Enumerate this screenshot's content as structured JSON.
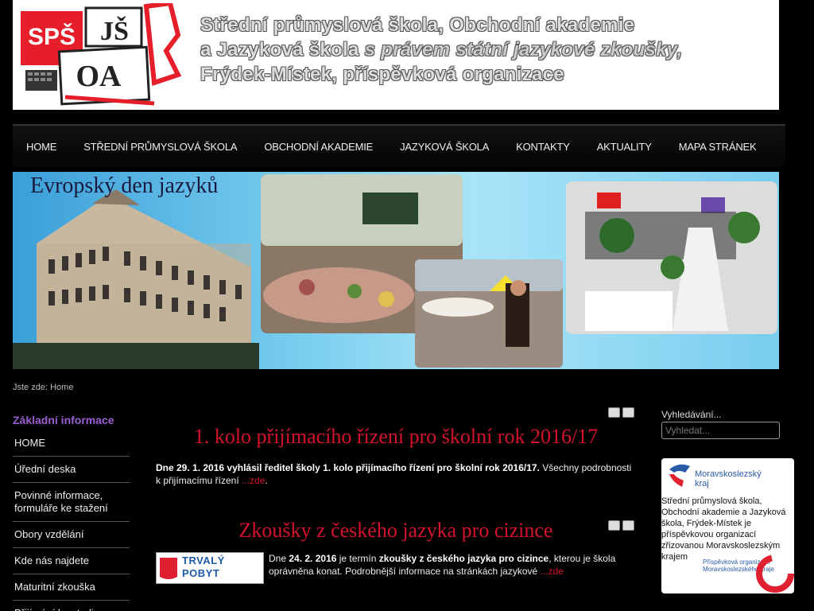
{
  "header": {
    "logo": {
      "line1_left": "SPŠ",
      "line1_right": "JŠ",
      "line2": "OA"
    },
    "line1": "Střední průmyslová škola, Obchodní akademie",
    "line2_prefix": "a Jazyková škola",
    "line2_italic": "s právem státní jazykové zkoušky,",
    "line3": "Frýdek-Místek, příspěvková organizace"
  },
  "nav": {
    "items": [
      "HOME",
      "STŘEDNÍ PRŮMYSLOVÁ ŠKOLA",
      "OBCHODNÍ AKADEMIE",
      "JAZYKOVÁ ŠKOLA",
      "KONTAKTY",
      "AKTUALITY",
      "MAPA STRÁNEK"
    ]
  },
  "hero": {
    "title": "Evropský den jazyků"
  },
  "breadcrumb": {
    "prefix": "Jste zde:",
    "current": "Home"
  },
  "left": {
    "title": "Základní informace",
    "items": [
      "HOME",
      "Úřední deska",
      "Povinné informace, formuláře ke stažení",
      "Obory vzdělání",
      "Kde nás najdete",
      "Maturitní zkouška",
      "Přijímání ke studiu"
    ]
  },
  "articles": [
    {
      "title": "1. kolo přijímacího řízení pro školní rok 2016/17",
      "text_bold": "Dne 29. 1. 2016 vyhlásil ředitel školy 1. kolo přijímacího řízení pro školní rok 2016/17.",
      "text_rest": "  Všechny podrobnosti k přijímacímu řízení",
      "link": "...zde",
      "end": "."
    },
    {
      "title": "Zkoušky z českého jazyka pro cizince",
      "badge": "TRVALÝ POBYT",
      "text_a": "Dne ",
      "text_b": "24. 2. 2016",
      "text_c": " je termín ",
      "text_d": "zkoušky z českého jazyka pro cizince",
      "text_e": ", kterou je škola oprávněna konat. Podrobnější informace na stránkách jazykové ",
      "link": "...zde"
    }
  ],
  "right": {
    "search_label": "Vyhledávání...",
    "search_placeholder": "Vyhledat...",
    "msk_logo_line1": "Moravskoslezský",
    "msk_logo_line2": "kraj",
    "msk_text": "Střední průmyslová škola, Obchodní akademie a Jazyková škola, Frýdek-Místek je příspěvkovou organizací zřizovanou Moravskoslezským krajem",
    "msk_sub1": "Příspěvková organizace",
    "msk_sub2": "Moravskoslezského kraje"
  },
  "colors": {
    "accent_red": "#d4122e",
    "accent_purple": "#9a5fd4",
    "msk_blue": "#2a5aa8"
  }
}
